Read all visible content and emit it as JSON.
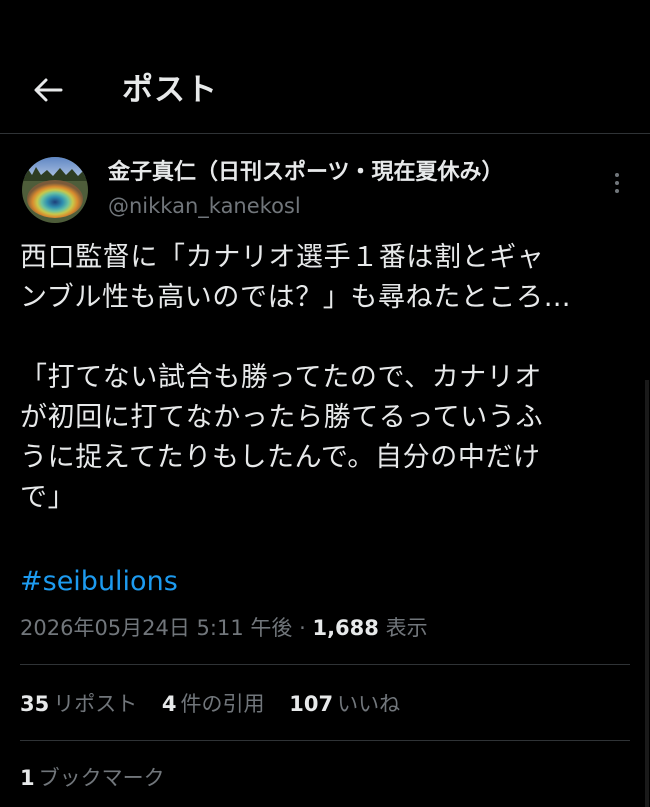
{
  "header": {
    "back_icon": "arrow-left-icon",
    "title": "ポスト"
  },
  "author": {
    "name": "金子真仁（日刊スポーツ・現在夏休み）",
    "handle": "@nikkan_kanekosl"
  },
  "post": {
    "text_line_1": "西口監督に「カナリオ選手１番は割とギャ",
    "text_line_2": "ンブル性も高いのでは？」も尋ねたところ…",
    "text_line_3": "「打てない試合も勝ってたので、カナリオ",
    "text_line_4": "が初回に打てなかったら勝てるっていうふ",
    "text_line_5": "うに捉えてたりもしたんで。自分の中だけ",
    "text_line_6": "で」",
    "hashtag": "#seibulions"
  },
  "meta": {
    "timestamp": "2026年05月24日 5:11 午後",
    "separator": "·",
    "views_count": "1,688",
    "views_label": "表示"
  },
  "stats": {
    "reposts_count": "35",
    "reposts_label": "リポスト",
    "quotes_count": "4",
    "quotes_label": "件の引用",
    "likes_count": "107",
    "likes_label": "いいね",
    "bookmarks_count": "1",
    "bookmarks_label": "ブックマーク"
  },
  "colors": {
    "background": "#000000",
    "text": "#e7e9ea",
    "secondary": "#71767b",
    "accent": "#1d9bf0",
    "divider": "#2f3336"
  }
}
